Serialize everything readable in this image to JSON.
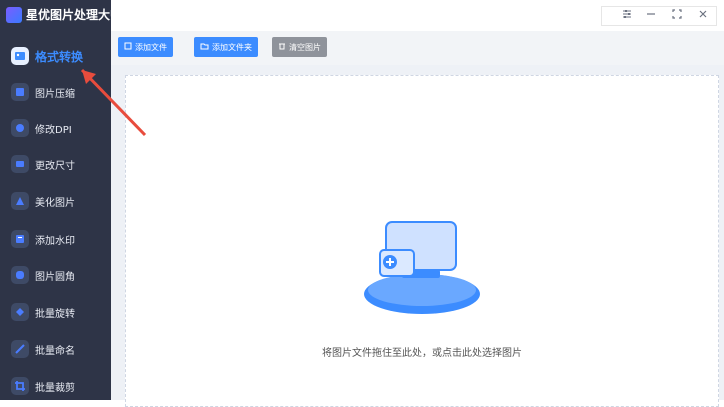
{
  "app": {
    "title": "星优图片处理大师"
  },
  "sidebar": {
    "items": [
      {
        "label": "格式转换",
        "icon": "image-convert-icon"
      },
      {
        "label": "图片压缩",
        "icon": "compress-icon"
      },
      {
        "label": "修改DPI",
        "icon": "dpi-icon"
      },
      {
        "label": "更改尺寸",
        "icon": "resize-icon"
      },
      {
        "label": "美化图片",
        "icon": "beautify-icon"
      },
      {
        "label": "添加水印",
        "icon": "watermark-icon"
      },
      {
        "label": "图片圆角",
        "icon": "rounded-corner-icon"
      },
      {
        "label": "批量旋转",
        "icon": "rotate-icon"
      },
      {
        "label": "批量命名",
        "icon": "rename-icon"
      },
      {
        "label": "批量裁剪",
        "icon": "crop-icon"
      }
    ]
  },
  "toolbar": {
    "add_file": "添加文件",
    "add_folder": "添加文件夹",
    "clear_images": "清空图片"
  },
  "main": {
    "drop_hint": "将图片文件拖住至此处，或点击此处选择图片"
  },
  "colors": {
    "accent": "#3c8cff",
    "sidebar_bg": "#2e3447",
    "annotation_arrow": "#e84c3d"
  }
}
